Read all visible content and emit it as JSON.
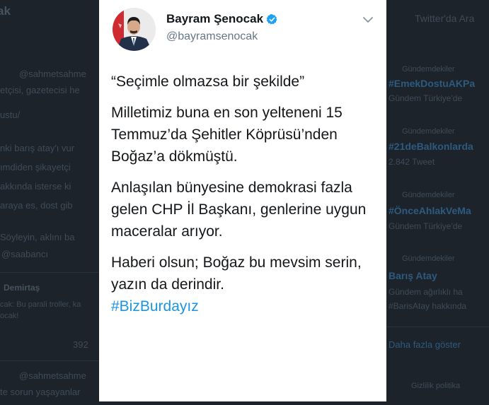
{
  "tweet": {
    "display_name": "Bayram Şenocak",
    "handle": "@bayramsenocak",
    "paragraphs": [
      "“Seçimle olmazsa bir şekilde”",
      "Milletimiz buna en son yelteneni 15 Temmuz’da Şehitler Köprüsü’nden Boğaz’a dökmüştü.",
      "Anlaşılan bünyesine demokrasi fazla gelen CHP İl Başkanı, genlerine uygun maceralar arıyor.",
      "Haberi olsun; Boğaz bu mevsim serin, yazın da derindir."
    ],
    "hashtag": "#BizBurdayız"
  },
  "background_left": [
    "ak",
    "@sahmetsahme",
    "etçisi, gazetecisi he",
    "ustu/",
    "nki barış atay'ı vur",
    "ımdiden şikayetçi",
    "akkında isterse ki",
    "araya es, dost gib",
    "Söyleyin, aklını ba",
    "@saabancı",
    "Demirtaş",
    "cak: Bu parali troller, ka",
    "ocak!",
    "392",
    "@sahmetsahme",
    "te sorun yaşayanlar"
  ],
  "background_right": [
    "Twitter'da Ara",
    "Gündemdekiler",
    "#EmekDostuAKPa",
    "Gündem Türkiye'de",
    "Gündemdekiler",
    "#21deBalkonlarda",
    "2.842 Tweet",
    "Gündemdekiler",
    "#ÖnceAhlakVeMa",
    "Gündem Türkiye'de",
    "Gündemdekiler",
    "Barış Atay",
    "Gündem ağırlıklı ha",
    "#BarisAtay hakkında",
    "Daha fazla göster",
    "Gizlilik politika"
  ],
  "colors": {
    "link": "#1b95e0",
    "verified": "#1da1f2",
    "text": "#14171a",
    "muted": "#657786",
    "page_bg": "#1c232b"
  },
  "icons": [
    "verified-badge-icon",
    "chevron-down-icon",
    "avatar"
  ]
}
